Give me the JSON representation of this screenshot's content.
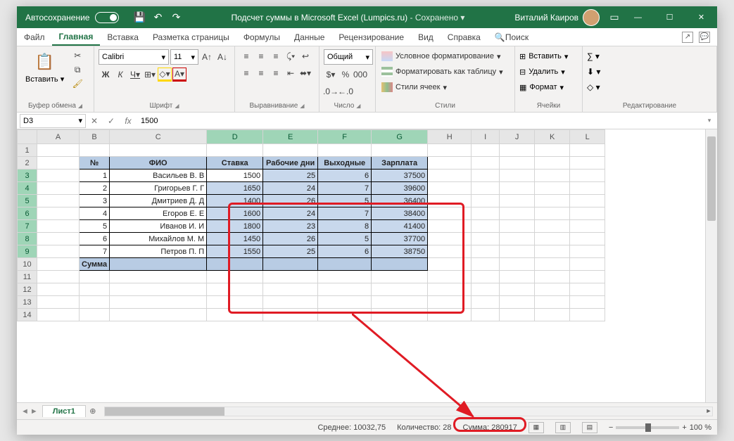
{
  "titlebar": {
    "autosave": "Автосохранение",
    "doc": "Подсчет суммы в Microsoft Excel (Lumpics.ru)",
    "saved": "Сохранено",
    "user": "Виталий Каиров"
  },
  "tabs": {
    "file": "Файл",
    "home": "Главная",
    "insert": "Вставка",
    "layout": "Разметка страницы",
    "formulas": "Формулы",
    "data": "Данные",
    "review": "Рецензирование",
    "view": "Вид",
    "help": "Справка",
    "search": "Поиск"
  },
  "ribbon": {
    "clipboard": {
      "paste": "Вставить",
      "label": "Буфер обмена"
    },
    "font": {
      "name": "Calibri",
      "size": "11",
      "label": "Шрифт",
      "b": "Ж",
      "i": "К",
      "u": "Ч"
    },
    "align": {
      "label": "Выравнивание"
    },
    "number": {
      "format": "Общий",
      "label": "Число"
    },
    "styles": {
      "cond": "Условное форматирование",
      "table": "Форматировать как таблицу",
      "cells": "Стили ячеек",
      "label": "Стили"
    },
    "cells": {
      "insert": "Вставить",
      "delete": "Удалить",
      "format": "Формат",
      "label": "Ячейки"
    },
    "editing": {
      "label": "Редактирование"
    }
  },
  "fbar": {
    "cell": "D3",
    "value": "1500"
  },
  "cols": [
    "A",
    "B",
    "C",
    "D",
    "E",
    "F",
    "G",
    "H",
    "I",
    "J",
    "K",
    "L"
  ],
  "headers": {
    "no": "№",
    "fio": "ФИО",
    "rate": "Ставка",
    "days": "Рабочие дни",
    "off": "Выходные",
    "salary": "Зарплата"
  },
  "rows": [
    {
      "n": "1",
      "fio": "Васильев В. В",
      "r": "1500",
      "d": "25",
      "o": "6",
      "s": "37500"
    },
    {
      "n": "2",
      "fio": "Григорьев Г. Г",
      "r": "1650",
      "d": "24",
      "o": "7",
      "s": "39600"
    },
    {
      "n": "3",
      "fio": "Дмитриев Д. Д",
      "r": "1400",
      "d": "26",
      "o": "5",
      "s": "36400"
    },
    {
      "n": "4",
      "fio": "Егоров Е. Е",
      "r": "1600",
      "d": "24",
      "o": "7",
      "s": "38400"
    },
    {
      "n": "5",
      "fio": "Иванов И. И",
      "r": "1800",
      "d": "23",
      "o": "8",
      "s": "41400"
    },
    {
      "n": "6",
      "fio": "Михайлов М. М",
      "r": "1450",
      "d": "26",
      "o": "5",
      "s": "37700"
    },
    {
      "n": "7",
      "fio": "Петров П. П",
      "r": "1550",
      "d": "25",
      "o": "6",
      "s": "38750"
    }
  ],
  "sumLabel": "Сумма",
  "sheet": "Лист1",
  "status": {
    "avg": "Среднее: 10032,75",
    "count": "Количество: 28",
    "sum": "Сумма: 280917",
    "zoom": "100 %"
  }
}
